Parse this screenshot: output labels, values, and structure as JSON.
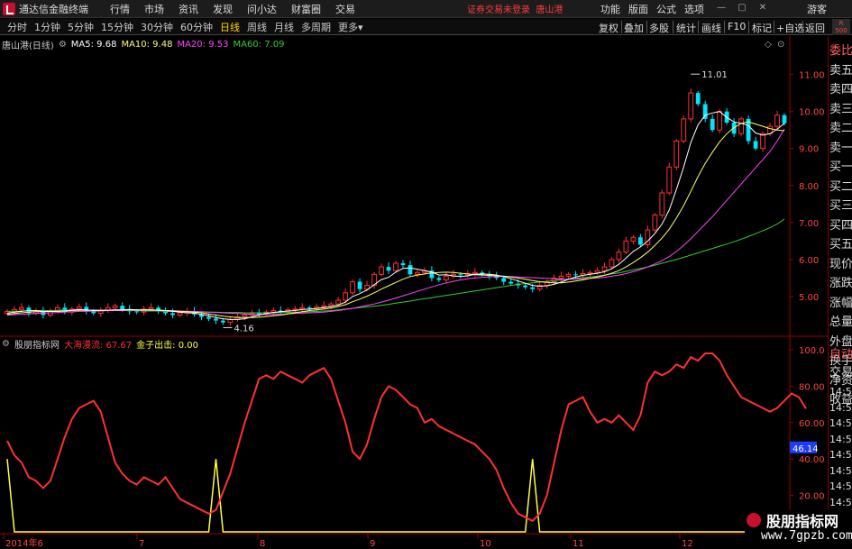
{
  "titlebar": {
    "app_name": "通达信金融终端",
    "menus": [
      "行情",
      "市场",
      "资讯",
      "发现",
      "问小达",
      "财富圈",
      "交易"
    ],
    "notice": "证券交易未登录",
    "stock": "唐山港",
    "right_menus": [
      "功能",
      "版面",
      "公式",
      "选项"
    ],
    "user": "游客",
    "controls": [
      "—",
      "▢",
      "✕"
    ]
  },
  "toolbar": {
    "periods": [
      "分时",
      "1分钟",
      "5分钟",
      "15分钟",
      "30分钟",
      "60分钟",
      "日线",
      "周线",
      "月线",
      "多周期",
      "更多"
    ],
    "active_period": "日线",
    "right_tools": [
      "复权",
      "叠加",
      "多股",
      "统计",
      "画线",
      "F10",
      "标记",
      "+自选",
      "返回"
    ],
    "badge_top": "R",
    "badge_bottom": "500"
  },
  "ma_legend": {
    "title": "唐山港(日线)",
    "ma5": "MA5: 9.68",
    "ma10": "MA10: 9.48",
    "ma20": "MA20: 9.53",
    "ma60": "MA60: 7.09",
    "colors": {
      "ma5": "#ffffff",
      "ma10": "#ffff66",
      "ma20": "#ff44ff",
      "ma60": "#33cc33"
    }
  },
  "indicator_legend": {
    "title": "股朋指标网",
    "line1": "大海漫流: 67.67",
    "line2": "金子出击: 0.00",
    "colors": {
      "line1": "#ff3030",
      "line2": "#ffff40"
    }
  },
  "price_axis": [
    "11.00",
    "10.00",
    "9.00",
    "8.00",
    "7.00",
    "6.00",
    "5.00"
  ],
  "indicator_axis": [
    "100.0",
    "80.00",
    "60.00",
    "40.00",
    "20.00"
  ],
  "indicator_tag": "46.14",
  "date_axis": [
    "2014年6",
    "7",
    "8",
    "9",
    "10",
    "11",
    "12"
  ],
  "annotations": {
    "high": "11.01",
    "low": "4.16"
  },
  "side_panel": {
    "items": [
      "委比",
      "卖五",
      "卖四",
      "卖三",
      "卖二",
      "卖一",
      "买一",
      "买二",
      "买三",
      "买四",
      "买五",
      "现价",
      "涨跌",
      "涨幅",
      "总量",
      "外盘",
      "换手",
      "净资",
      "收益"
    ],
    "bottom_items": [
      "自动",
      "交易"
    ],
    "times": [
      "14:56",
      "14:56",
      "14:56",
      "14:56",
      "14:56",
      "14:56",
      "14:56",
      "14:56",
      "14:56",
      "14:56"
    ]
  },
  "watermark": {
    "title": "股朋指标网",
    "url": "www.7gpzb.com"
  },
  "chart_data": {
    "type": "line",
    "panels": [
      "candlestick",
      "indicator"
    ],
    "price_ylim": [
      4.0,
      11.6
    ],
    "indicator_ylim": [
      0,
      100
    ],
    "closes": [
      4.6,
      4.65,
      4.7,
      4.55,
      4.6,
      4.5,
      4.62,
      4.7,
      4.58,
      4.66,
      4.72,
      4.6,
      4.55,
      4.62,
      4.7,
      4.75,
      4.65,
      4.6,
      4.58,
      4.66,
      4.7,
      4.62,
      4.55,
      4.5,
      4.56,
      4.6,
      4.52,
      4.45,
      4.4,
      4.35,
      4.3,
      4.38,
      4.45,
      4.5,
      4.55,
      4.52,
      4.58,
      4.62,
      4.6,
      4.64,
      4.66,
      4.7,
      4.68,
      4.72,
      4.75,
      4.8,
      4.9,
      5.1,
      5.4,
      5.2,
      5.3,
      5.6,
      5.8,
      5.7,
      5.9,
      5.85,
      5.6,
      5.65,
      5.7,
      5.5,
      5.45,
      5.55,
      5.6,
      5.58,
      5.62,
      5.65,
      5.6,
      5.55,
      5.5,
      5.4,
      5.35,
      5.3,
      5.25,
      5.2,
      5.3,
      5.4,
      5.5,
      5.55,
      5.6,
      5.58,
      5.62,
      5.65,
      5.7,
      5.8,
      6.0,
      6.2,
      6.5,
      6.6,
      6.4,
      6.8,
      7.2,
      7.8,
      8.5,
      9.2,
      9.8,
      10.5,
      10.2,
      9.8,
      9.5,
      10.0,
      9.7,
      9.4,
      9.8,
      9.2,
      9.0,
      9.4,
      9.6,
      9.9,
      9.68
    ],
    "ma5": [
      4.55,
      4.58,
      4.6,
      4.62,
      4.62,
      4.6,
      4.6,
      4.6,
      4.61,
      4.63,
      4.65,
      4.64,
      4.62,
      4.62,
      4.63,
      4.64,
      4.64,
      4.65,
      4.64,
      4.64,
      4.64,
      4.63,
      4.62,
      4.6,
      4.58,
      4.56,
      4.55,
      4.52,
      4.48,
      4.43,
      4.4,
      4.38,
      4.38,
      4.4,
      4.45,
      4.5,
      4.54,
      4.57,
      4.59,
      4.61,
      4.62,
      4.65,
      4.66,
      4.68,
      4.7,
      4.73,
      4.77,
      4.85,
      5.0,
      5.08,
      5.18,
      5.32,
      5.46,
      5.52,
      5.66,
      5.76,
      5.77,
      5.74,
      5.7,
      5.66,
      5.58,
      5.59,
      5.56,
      5.54,
      5.56,
      5.6,
      5.61,
      5.6,
      5.58,
      5.54,
      5.48,
      5.42,
      5.36,
      5.3,
      5.28,
      5.29,
      5.33,
      5.39,
      5.47,
      5.53,
      5.57,
      5.6,
      5.63,
      5.67,
      5.75,
      5.87,
      6.04,
      6.22,
      6.34,
      6.5,
      6.7,
      6.96,
      7.34,
      7.9,
      8.5,
      9.16,
      9.64,
      9.9,
      9.96,
      10.0,
      9.84,
      9.72,
      9.68,
      9.62,
      9.42,
      9.36,
      9.4,
      9.52,
      9.68
    ],
    "ma10": [
      4.52,
      4.54,
      4.56,
      4.58,
      4.59,
      4.59,
      4.6,
      4.6,
      4.61,
      4.62,
      4.63,
      4.63,
      4.63,
      4.63,
      4.63,
      4.64,
      4.64,
      4.64,
      4.64,
      4.64,
      4.64,
      4.63,
      4.62,
      4.61,
      4.6,
      4.59,
      4.58,
      4.56,
      4.53,
      4.5,
      4.47,
      4.45,
      4.43,
      4.43,
      4.43,
      4.44,
      4.46,
      4.48,
      4.5,
      4.53,
      4.56,
      4.59,
      4.62,
      4.64,
      4.66,
      4.69,
      4.73,
      4.78,
      4.86,
      4.93,
      5.01,
      5.1,
      5.2,
      5.29,
      5.38,
      5.47,
      5.54,
      5.58,
      5.61,
      5.64,
      5.65,
      5.66,
      5.65,
      5.63,
      5.61,
      5.59,
      5.58,
      5.57,
      5.56,
      5.55,
      5.53,
      5.5,
      5.47,
      5.43,
      5.4,
      5.38,
      5.37,
      5.37,
      5.39,
      5.42,
      5.45,
      5.49,
      5.53,
      5.57,
      5.63,
      5.7,
      5.8,
      5.92,
      6.05,
      6.2,
      6.38,
      6.58,
      6.82,
      7.12,
      7.46,
      7.84,
      8.24,
      8.6,
      8.9,
      9.18,
      9.4,
      9.56,
      9.68,
      9.72,
      9.66,
      9.6,
      9.54,
      9.5,
      9.48
    ],
    "ma20": [
      4.5,
      4.51,
      4.52,
      4.53,
      4.54,
      4.55,
      4.56,
      4.57,
      4.58,
      4.59,
      4.6,
      4.6,
      4.61,
      4.61,
      4.62,
      4.62,
      4.62,
      4.63,
      4.63,
      4.63,
      4.63,
      4.63,
      4.62,
      4.62,
      4.61,
      4.6,
      4.6,
      4.59,
      4.58,
      4.57,
      4.56,
      4.55,
      4.54,
      4.53,
      4.52,
      4.52,
      4.52,
      4.52,
      4.52,
      4.53,
      4.54,
      4.55,
      4.56,
      4.57,
      4.58,
      4.6,
      4.62,
      4.65,
      4.68,
      4.72,
      4.76,
      4.8,
      4.85,
      4.9,
      4.96,
      5.02,
      5.08,
      5.14,
      5.2,
      5.26,
      5.32,
      5.37,
      5.41,
      5.45,
      5.48,
      5.5,
      5.52,
      5.53,
      5.54,
      5.54,
      5.54,
      5.53,
      5.52,
      5.51,
      5.5,
      5.49,
      5.48,
      5.47,
      5.47,
      5.47,
      5.48,
      5.49,
      5.5,
      5.52,
      5.55,
      5.58,
      5.62,
      5.67,
      5.73,
      5.8,
      5.88,
      5.97,
      6.08,
      6.22,
      6.38,
      6.56,
      6.76,
      6.96,
      7.16,
      7.38,
      7.6,
      7.82,
      8.04,
      8.26,
      8.48,
      8.7,
      8.92,
      9.2,
      9.53
    ],
    "ma60": [
      4.6,
      4.6,
      4.61,
      4.61,
      4.62,
      4.62,
      4.62,
      4.63,
      4.63,
      4.63,
      4.63,
      4.63,
      4.63,
      4.63,
      4.63,
      4.62,
      4.62,
      4.62,
      4.62,
      4.61,
      4.61,
      4.61,
      4.6,
      4.6,
      4.6,
      4.59,
      4.59,
      4.58,
      4.58,
      4.58,
      4.57,
      4.57,
      4.57,
      4.56,
      4.56,
      4.56,
      4.56,
      4.56,
      4.57,
      4.57,
      4.58,
      4.58,
      4.59,
      4.6,
      4.61,
      4.62,
      4.64,
      4.66,
      4.68,
      4.7,
      4.72,
      4.74,
      4.76,
      4.79,
      4.82,
      4.85,
      4.88,
      4.91,
      4.94,
      4.97,
      5.0,
      5.03,
      5.06,
      5.09,
      5.12,
      5.15,
      5.18,
      5.21,
      5.24,
      5.27,
      5.3,
      5.33,
      5.35,
      5.37,
      5.39,
      5.41,
      5.43,
      5.45,
      5.47,
      5.49,
      5.51,
      5.53,
      5.55,
      5.58,
      5.61,
      5.64,
      5.68,
      5.72,
      5.76,
      5.8,
      5.85,
      5.9,
      5.95,
      6.0,
      6.06,
      6.12,
      6.18,
      6.24,
      6.3,
      6.36,
      6.42,
      6.48,
      6.55,
      6.62,
      6.7,
      6.78,
      6.86,
      6.96,
      7.09
    ],
    "line1": [
      50,
      42,
      38,
      30,
      28,
      24,
      28,
      40,
      52,
      62,
      68,
      70,
      72,
      66,
      52,
      38,
      32,
      28,
      26,
      30,
      28,
      26,
      30,
      24,
      18,
      16,
      14,
      12,
      10,
      12,
      22,
      32,
      46,
      60,
      72,
      84,
      86,
      84,
      88,
      86,
      84,
      82,
      86,
      88,
      90,
      84,
      72,
      60,
      44,
      40,
      48,
      62,
      74,
      80,
      78,
      74,
      70,
      68,
      60,
      62,
      58,
      56,
      54,
      52,
      50,
      48,
      44,
      40,
      34,
      24,
      16,
      10,
      8,
      6,
      10,
      20,
      38,
      56,
      70,
      72,
      74,
      66,
      60,
      62,
      60,
      64,
      60,
      56,
      64,
      82,
      88,
      86,
      88,
      92,
      90,
      96,
      94,
      98,
      98,
      94,
      86,
      80,
      74,
      72,
      70,
      68,
      66,
      68,
      72,
      76,
      74,
      67.67
    ],
    "line2": [
      40,
      0,
      0,
      0,
      0,
      0,
      0,
      0,
      0,
      0,
      0,
      0,
      0,
      0,
      0,
      0,
      0,
      0,
      0,
      0,
      0,
      0,
      0,
      0,
      0,
      0,
      0,
      0,
      0,
      40,
      0,
      0,
      0,
      0,
      0,
      0,
      0,
      0,
      0,
      0,
      0,
      0,
      0,
      0,
      0,
      0,
      0,
      0,
      0,
      0,
      0,
      0,
      0,
      0,
      0,
      0,
      0,
      0,
      0,
      0,
      0,
      0,
      0,
      0,
      0,
      0,
      0,
      0,
      0,
      0,
      0,
      0,
      0,
      40,
      0,
      0,
      0,
      0,
      0,
      0,
      0,
      0,
      0,
      0,
      0,
      0,
      0,
      0,
      0,
      0,
      0,
      0,
      0,
      0,
      0,
      0,
      0,
      0,
      0,
      0,
      0,
      0,
      0,
      0,
      0,
      0,
      0,
      0,
      0,
      0,
      0,
      0,
      0.0
    ]
  }
}
